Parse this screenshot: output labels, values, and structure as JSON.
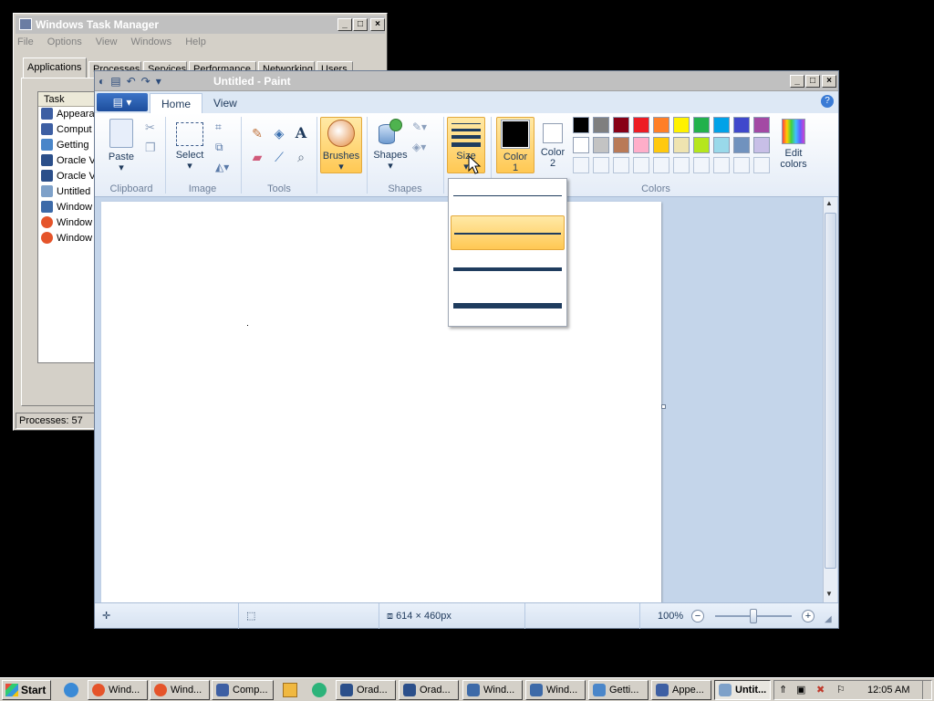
{
  "taskmgr": {
    "title": "Windows Task Manager",
    "menu": [
      "File",
      "Options",
      "View",
      "Windows",
      "Help"
    ],
    "tabs": [
      "Applications",
      "Processes",
      "Services",
      "Performance",
      "Networking",
      "Users"
    ],
    "col_task": "Task",
    "rows": [
      "Appeara",
      "Comput",
      "Getting",
      "Oracle V",
      "Oracle V",
      "Untitled",
      "Window",
      "Window",
      "Window"
    ],
    "status": "Processes: 57"
  },
  "paint": {
    "title": "Untitled - Paint",
    "ribbon_tabs": [
      "Home",
      "View"
    ],
    "clipboard": {
      "paste": "Paste",
      "label": "Clipboard"
    },
    "image": {
      "select": "Select",
      "label": "Image"
    },
    "tools": {
      "label": "Tools"
    },
    "brushes": "Brushes",
    "shapes": {
      "btn": "Shapes",
      "label": "Shapes"
    },
    "size": "Size",
    "color1": "Color 1",
    "color2": "Color 2",
    "edit_colors": "Edit colors",
    "colors_label": "Colors",
    "palette_row1": [
      "#000000",
      "#7f7f7f",
      "#880015",
      "#ed1c24",
      "#ff7f27",
      "#fff200",
      "#22b14c",
      "#00a2e8",
      "#3f48cc",
      "#a349a4"
    ],
    "palette_row2": [
      "#ffffff",
      "#c3c3c3",
      "#b97a57",
      "#ffaec9",
      "#ffc90e",
      "#efe4b0",
      "#b5e61d",
      "#99d9ea",
      "#7092be",
      "#c8bfe7"
    ],
    "status": {
      "dimensions": "614 × 460px",
      "zoom": "100%"
    }
  },
  "taskbar": {
    "start": "Start",
    "buttons": [
      "Wind...",
      "Wind...",
      "Comp...",
      "Orad...",
      "Orad...",
      "Wind...",
      "Wind...",
      "Getti...",
      "Appe...",
      "Untit..."
    ],
    "clock": "12:05 AM"
  }
}
